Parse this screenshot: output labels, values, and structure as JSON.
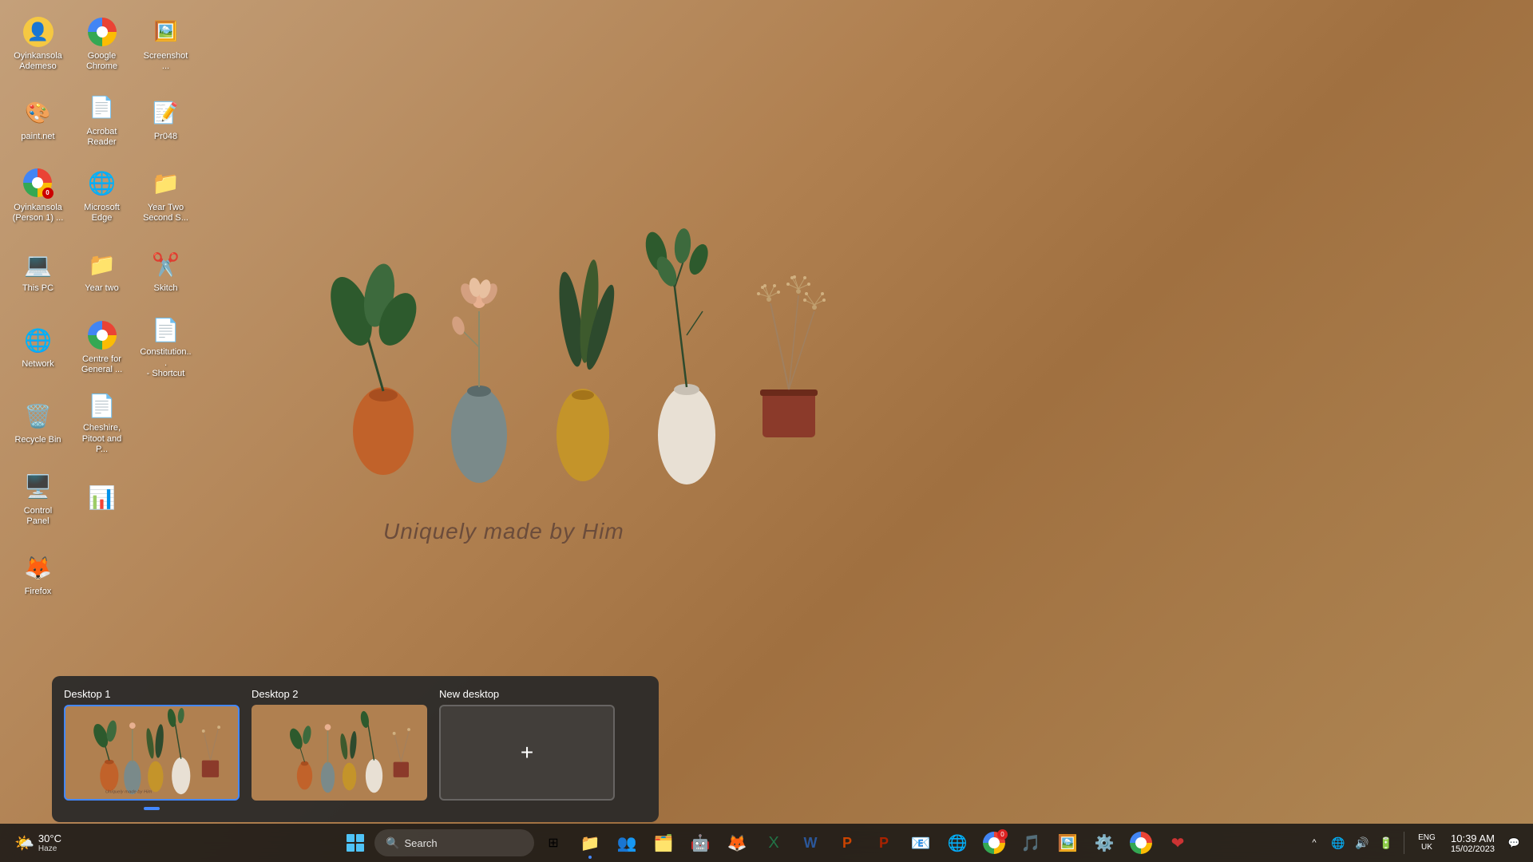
{
  "desktop": {
    "background_color": "#b08050",
    "wallpaper_text": "Uniquely made by Him"
  },
  "icons": [
    {
      "id": "user-profile",
      "label": "Oyinkansola\nAdemeso",
      "emoji": "👤",
      "color": "#f5c842",
      "row": 0,
      "col": 0
    },
    {
      "id": "google-chrome",
      "label": "Google\nChrome",
      "emoji": "🌐",
      "color": "#4285f4",
      "row": 0,
      "col": 1
    },
    {
      "id": "screenshot-tool",
      "label": "Screenshot ...",
      "emoji": "🖼️",
      "color": "#888",
      "row": 0,
      "col": 2
    },
    {
      "id": "paintnet",
      "label": "paint.net",
      "emoji": "🎨",
      "color": "#888",
      "row": 1,
      "col": 0
    },
    {
      "id": "acrobat-reader",
      "label": "Acrobat\nReader",
      "emoji": "📄",
      "color": "#cc0000",
      "row": 1,
      "col": 1
    },
    {
      "id": "pr048",
      "label": "Pr048",
      "emoji": "📝",
      "color": "#2b579a",
      "row": 1,
      "col": 2
    },
    {
      "id": "oyinkansola-person1",
      "label": "Oyinkansola\n(Person 1) ...",
      "emoji": "🌐",
      "color": "#4285f4",
      "row": 2,
      "col": 0
    },
    {
      "id": "microsoft-edge",
      "label": "Microsoft\nEdge",
      "emoji": "🌐",
      "color": "#0078d4",
      "row": 2,
      "col": 1
    },
    {
      "id": "year-two-second-s",
      "label": "Year Two\nSecond S...",
      "emoji": "📁",
      "color": "#f5c842",
      "row": 2,
      "col": 2
    },
    {
      "id": "this-pc",
      "label": "This PC",
      "emoji": "💻",
      "color": "#4499ff",
      "row": 3,
      "col": 0
    },
    {
      "id": "year-two",
      "label": "Year two",
      "emoji": "📁",
      "color": "#f5c842",
      "row": 3,
      "col": 1
    },
    {
      "id": "skitch",
      "label": "Skitch",
      "emoji": "✂️",
      "color": "#e83030",
      "row": 3,
      "col": 2
    },
    {
      "id": "network",
      "label": "Network",
      "emoji": "🌐",
      "color": "#4499ff",
      "row": 4,
      "col": 0
    },
    {
      "id": "centre-general",
      "label": "Centre for\nGeneral ...",
      "emoji": "🌐",
      "color": "#4285f4",
      "row": 4,
      "col": 1
    },
    {
      "id": "constitution-shortcut",
      "label": "Constitution...\n- Shortcut",
      "emoji": "📄",
      "color": "#cc0000",
      "row": 4,
      "col": 2
    },
    {
      "id": "recycle-bin",
      "label": "Recycle Bin",
      "emoji": "🗑️",
      "color": "#aaccff",
      "row": 5,
      "col": 0
    },
    {
      "id": "cheshire-pitoot",
      "label": "Cheshire,\nPitoot and P...",
      "emoji": "📄",
      "color": "#cc0000",
      "row": 5,
      "col": 1
    },
    {
      "id": "control-panel",
      "label": "Control Panel",
      "emoji": "🖥️",
      "color": "#66aaff",
      "row": 6,
      "col": 0
    },
    {
      "id": "excel-app",
      "label": "",
      "emoji": "📊",
      "color": "#217346",
      "row": 6,
      "col": 1
    },
    {
      "id": "firefox",
      "label": "Firefox",
      "emoji": "🦊",
      "color": "#ff6611",
      "row": 7,
      "col": 0
    }
  ],
  "virtual_desktops": {
    "label_desktop1": "Desktop 1",
    "label_desktop2": "Desktop 2",
    "label_new": "New desktop",
    "plus_icon": "+"
  },
  "taskbar": {
    "search_placeholder": "Search",
    "search_icon": "🔍",
    "apps": [
      {
        "id": "file-explorer",
        "emoji": "📁",
        "running": true,
        "badge": null
      },
      {
        "id": "teams",
        "emoji": "👥",
        "running": false,
        "badge": null
      },
      {
        "id": "file-manager",
        "emoji": "🗂️",
        "running": false,
        "badge": null
      },
      {
        "id": "copilot",
        "emoji": "🤖",
        "running": false,
        "badge": null
      },
      {
        "id": "firefox-task",
        "emoji": "🦊",
        "running": false,
        "badge": null
      },
      {
        "id": "excel-task",
        "emoji": "📊",
        "running": false,
        "badge": null
      },
      {
        "id": "word-task",
        "emoji": "📝",
        "running": false,
        "badge": null
      },
      {
        "id": "powerpoint-task",
        "emoji": "📊",
        "running": false,
        "badge": null
      },
      {
        "id": "powerpoint2-task",
        "emoji": "📈",
        "running": false,
        "badge": null
      },
      {
        "id": "mail-task",
        "emoji": "📧",
        "running": false,
        "badge": null
      },
      {
        "id": "app1",
        "emoji": "🌐",
        "running": false,
        "badge": null
      },
      {
        "id": "chrome-task",
        "emoji": "🌐",
        "running": false,
        "badge": "0"
      },
      {
        "id": "app2",
        "emoji": "🎵",
        "running": false,
        "badge": null
      },
      {
        "id": "photos-task",
        "emoji": "🖼️",
        "running": false,
        "badge": null
      },
      {
        "id": "settings-task",
        "emoji": "⚙️",
        "running": false,
        "badge": null
      },
      {
        "id": "chrome2-task",
        "emoji": "🌐",
        "running": false,
        "badge": null
      },
      {
        "id": "app3",
        "emoji": "🎯",
        "running": false,
        "badge": null
      }
    ],
    "sys_tray": {
      "chevron": "^",
      "network_icon": "📶",
      "volume_icon": "🔊",
      "battery_icon": "🔋",
      "lang": "ENG\nUK",
      "time": "10:39 AM",
      "date": "15/02/2023"
    },
    "weather": {
      "icon": "🌤️",
      "temp": "30°C",
      "description": "Haze"
    }
  }
}
